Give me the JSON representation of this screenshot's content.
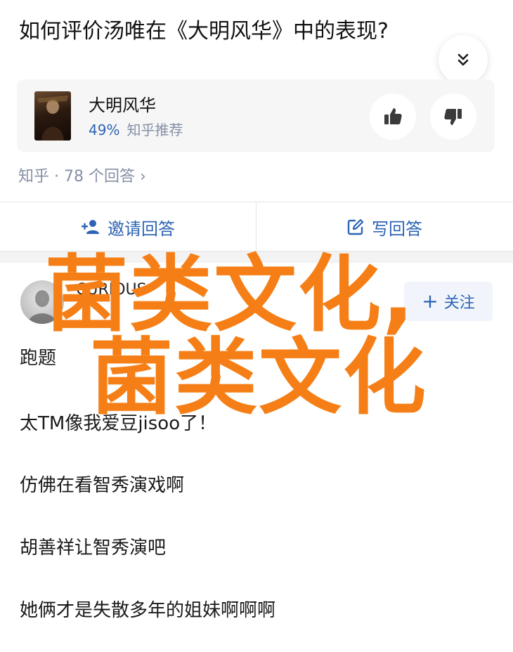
{
  "question": {
    "title": "如何评价汤唯在《大明风华》中的表现?"
  },
  "card": {
    "title": "大明风华",
    "recommend_pct": "49%",
    "recommend_label": "知乎推荐"
  },
  "meta": {
    "text": "知乎 · 78 个回答 ›"
  },
  "actions": {
    "invite": "邀请回答",
    "write": "写回答"
  },
  "author": {
    "name": "CURIOUS",
    "badge": ""
  },
  "follow": {
    "label": "关注"
  },
  "answer": {
    "lines": [
      "跑题",
      "太TM像我爱豆jisoo了！",
      "仿佛在看智秀演戏啊",
      "胡善祥让智秀演吧",
      "她俩才是失散多年的姐妹啊啊啊"
    ]
  },
  "watermark": {
    "line1": "菌类文化,",
    "line2": "菌类文化"
  },
  "colors": {
    "accent": "#2d64b3",
    "muted": "#8590a6",
    "watermark": "#f57f16"
  },
  "icons": {
    "collapse": "chevrons-down-icon",
    "upvote": "thumbs-up-icon",
    "downvote": "thumbs-down-icon",
    "invite": "user-plus-icon",
    "write": "edit-icon"
  }
}
